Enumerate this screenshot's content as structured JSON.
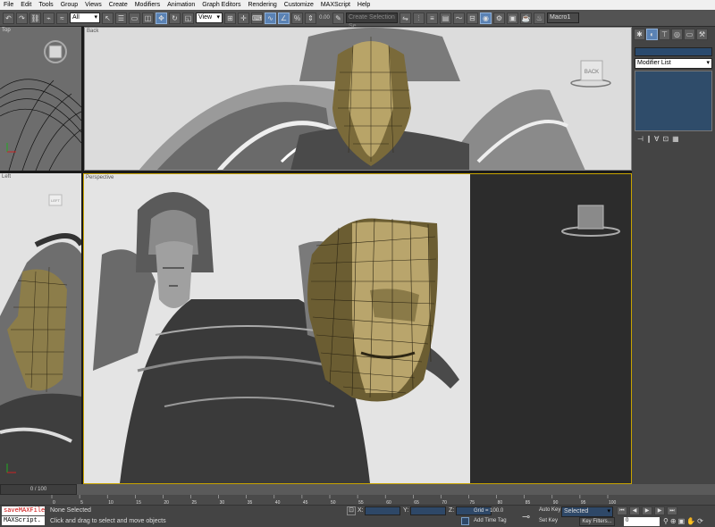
{
  "menu": [
    "File",
    "Edit",
    "Tools",
    "Group",
    "Views",
    "Create",
    "Modifiers",
    "Animation",
    "Graph Editors",
    "Rendering",
    "Customize",
    "MAXScript",
    "Help"
  ],
  "toolbar": {
    "filter": "All",
    "ref_coord": "View",
    "spinner": "0.00",
    "selection_set": "Create Selection Se",
    "macro": "Macro1"
  },
  "viewports": {
    "top": "Top",
    "back": "Back",
    "left": "Left",
    "perspective": "Perspective"
  },
  "viewcube": {
    "back": "BACK",
    "left": "LEFT"
  },
  "command_panel": {
    "modifier_list": "Modifier List"
  },
  "timeline": {
    "frame": "0 / 100",
    "ticks": [
      "0",
      "5",
      "10",
      "15",
      "20",
      "25",
      "30",
      "35",
      "40",
      "45",
      "50",
      "55",
      "60",
      "65",
      "70",
      "75",
      "80",
      "85",
      "90",
      "95",
      "100"
    ]
  },
  "status": {
    "script1": "saveMAXFile",
    "script2": "MAXScript.",
    "selection": "None Selected",
    "prompt": "Click and drag to select and move objects",
    "x_label": "X:",
    "y_label": "Y:",
    "z_label": "Z:",
    "grid": "Grid = 100.0",
    "add_time_tag": "Add Time Tag",
    "auto_key": "Auto Key",
    "set_key": "Set Key",
    "key_mode": "Selected",
    "key_filters": "Key Filters...",
    "frame_field": "0"
  },
  "colors": {
    "accent": "#5a82b4",
    "active_border": "#c8a400",
    "key_red": "#c83228"
  }
}
